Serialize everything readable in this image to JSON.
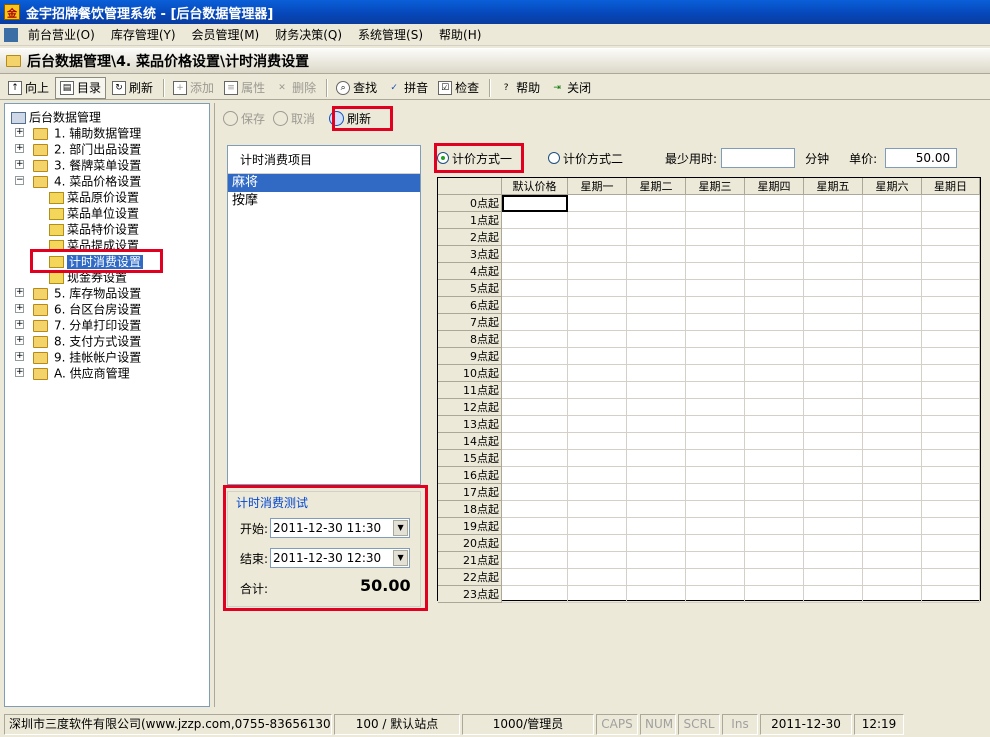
{
  "window": {
    "title": "金宇招牌餐饮管理系统 - [后台数据管理器]"
  },
  "menu": [
    "前台营业(O)",
    "库存管理(Y)",
    "会员管理(M)",
    "财务决策(Q)",
    "系统管理(S)",
    "帮助(H)"
  ],
  "breadcrumb": "后台数据管理\\4. 菜品价格设置\\计时消费设置",
  "toolbar": {
    "up": "向上",
    "catalog": "目录",
    "refresh": "刷新",
    "add": "添加",
    "props": "属性",
    "delete": "删除",
    "find": "查找",
    "pinyin": "拼音",
    "check": "检查",
    "help": "帮助",
    "close": "关闭"
  },
  "tree": {
    "root": "后台数据管理",
    "nodes": [
      "1. 辅助数据管理",
      "2. 部门出品设置",
      "3. 餐牌菜单设置",
      "4. 菜品价格设置",
      "菜品原价设置",
      "菜品单位设置",
      "菜品特价设置",
      "菜品提成设置",
      "计时消费设置",
      "现金券设置",
      "5. 库存物品设置",
      "6. 台区台房设置",
      "7. 分单打印设置",
      "8. 支付方式设置",
      "9. 挂帐帐户设置",
      "A. 供应商管理"
    ]
  },
  "content_toolbar": {
    "save": "保存",
    "cancel": "取消",
    "refresh": "刷新"
  },
  "items": {
    "header": "计时消费项目",
    "list": [
      "麻将",
      "按摩"
    ]
  },
  "test": {
    "title": "计时消费测试",
    "start_label": "开始:",
    "start_value": "2011-12-30 11:30",
    "end_label": "结束:",
    "end_value": "2011-12-30 12:30",
    "total_label": "合计:",
    "total_value": "50.00"
  },
  "pricing": {
    "mode1": "计价方式一",
    "mode2": "计价方式二",
    "min_label": "最少用时:",
    "min_value": "",
    "minute_unit": "分钟",
    "price_label": "单价:",
    "price_value": "50.00"
  },
  "grid": {
    "columns": [
      "默认价格",
      "星期一",
      "星期二",
      "星期三",
      "星期四",
      "星期五",
      "星期六",
      "星期日"
    ],
    "rows": [
      "0点起",
      "1点起",
      "2点起",
      "3点起",
      "4点起",
      "5点起",
      "6点起",
      "7点起",
      "8点起",
      "9点起",
      "10点起",
      "11点起",
      "12点起",
      "13点起",
      "14点起",
      "15点起",
      "16点起",
      "17点起",
      "18点起",
      "19点起",
      "20点起",
      "21点起",
      "22点起",
      "23点起"
    ]
  },
  "status": {
    "company": "深圳市三度软件有限公司(www.jzzp.com,0755-83656130)",
    "station": "100 / 默认站点",
    "user": "1000/管理员",
    "caps": "CAPS",
    "num": "NUM",
    "scrl": "SCRL",
    "ins": "Ins",
    "date": "2011-12-30",
    "time": "12:19"
  }
}
